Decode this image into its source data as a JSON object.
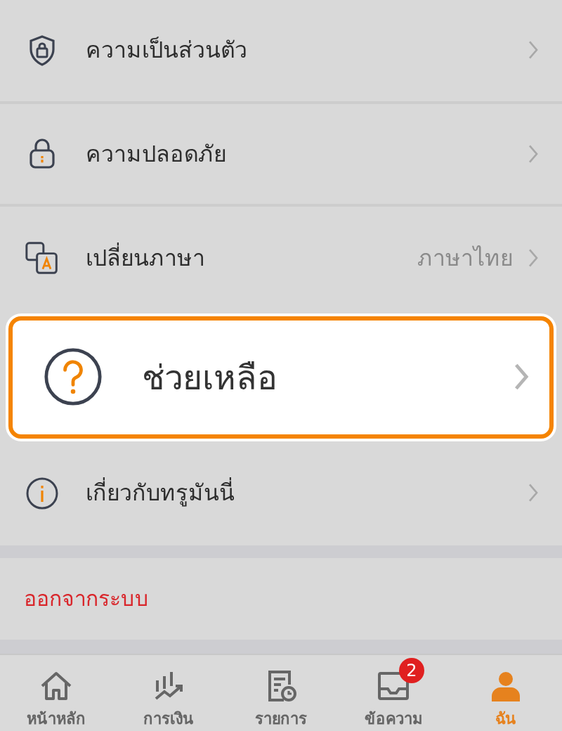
{
  "menu": [
    {
      "label": "ความเป็นส่วนตัว",
      "kind": "normal"
    },
    {
      "label": "ความปลอดภัย",
      "kind": "normal"
    },
    {
      "label": "เปลี่ยนภาษา",
      "value": "ภาษาไทย",
      "kind": "normal"
    },
    {
      "label": "ช่วยเหลือ",
      "kind": "highlighted"
    },
    {
      "label": "เกี่ยวกับทรูมันนี่",
      "kind": "normal"
    }
  ],
  "logout": "ออกจากระบบ",
  "nav": [
    {
      "label": "หน้าหลัก",
      "selected": false
    },
    {
      "label": "การเงิน",
      "selected": false
    },
    {
      "label": "รายการ",
      "selected": false
    },
    {
      "label": "ข้อความ",
      "selected": false,
      "badge": "2"
    },
    {
      "label": "ฉัน",
      "selected": true
    }
  ]
}
